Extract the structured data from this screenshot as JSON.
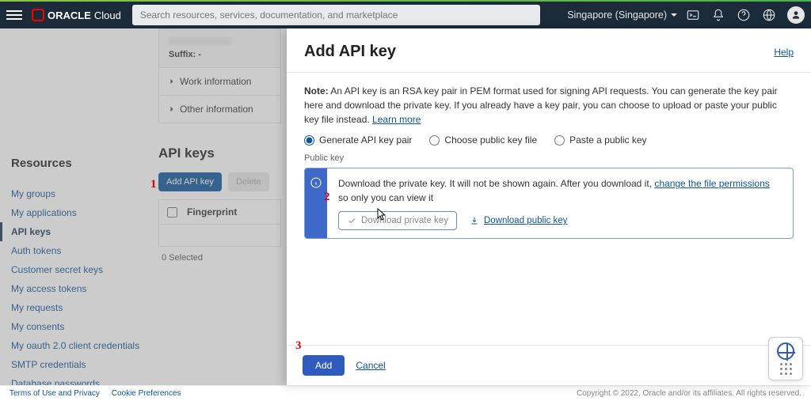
{
  "topbar": {
    "brand_a": "ORACLE",
    "brand_b": "Cloud",
    "search_placeholder": "Search resources, services, documentation, and marketplace",
    "region": "Singapore (Singapore)"
  },
  "infocard": {
    "suffix_label": "Suffix: -",
    "accordion1": "Work information",
    "accordion2": "Other information"
  },
  "resources": {
    "heading": "Resources",
    "items": [
      "My groups",
      "My applications",
      "API keys",
      "Auth tokens",
      "Customer secret keys",
      "My access tokens",
      "My requests",
      "My consents",
      "My oauth 2.0 client credentials",
      "SMTP credentials",
      "Database passwords"
    ],
    "active_index": 2
  },
  "apikeys": {
    "heading": "API keys",
    "add_btn": "Add API key",
    "delete_btn": "Delete",
    "col_fingerprint": "Fingerprint",
    "selected_text": "0 Selected"
  },
  "panel": {
    "title": "Add API key",
    "help": "Help",
    "note_strong": "Note:",
    "note_body": " An API key is an RSA key pair in PEM format used for signing API requests. You can generate the key pair here and download the private key. If you already have a key pair, you can choose to upload or paste your public key file instead. ",
    "note_link": "Learn more",
    "radio1": "Generate API key pair",
    "radio2": "Choose public key file",
    "radio3": "Paste a public key",
    "public_key_label": "Public key",
    "info_msg_a": "Download the private key. It will not be shown again. After you download it, ",
    "info_link": "change the file permissions",
    "info_msg_b": " so only you can view it",
    "dl_private": "Download private key",
    "dl_public": "Download public key",
    "add_btn": "Add",
    "cancel": "Cancel"
  },
  "marks": {
    "m1": "1",
    "m2": "2",
    "m3": "3"
  },
  "footer": {
    "link1": "Terms of Use and Privacy",
    "link2": "Cookie Preferences",
    "copy": "Copyright © 2022, Oracle and/or its affiliates. All rights reserved."
  }
}
